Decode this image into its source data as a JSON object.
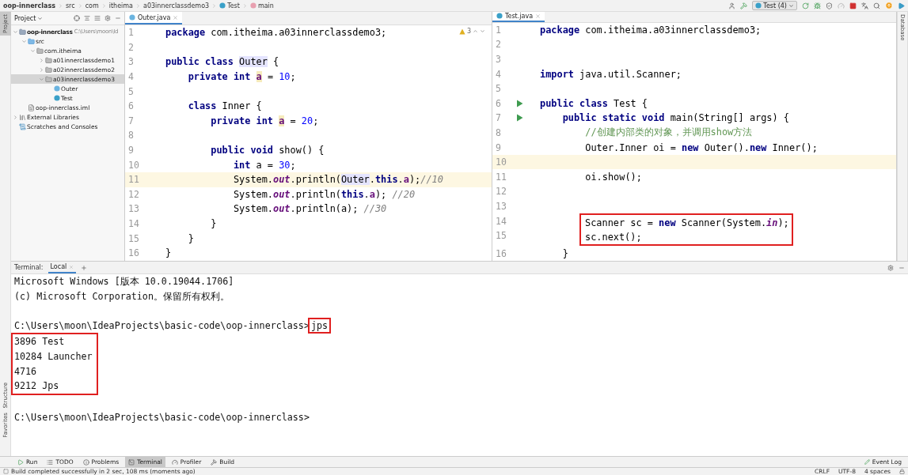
{
  "breadcrumbs": [
    {
      "kind": "project",
      "text": "oop-innerclass"
    },
    {
      "kind": "folder",
      "text": "src"
    },
    {
      "kind": "folder",
      "text": "com"
    },
    {
      "kind": "folder",
      "text": "itheima"
    },
    {
      "kind": "folder",
      "text": "a03innerclassdemo3"
    },
    {
      "kind": "class",
      "text": "Test"
    },
    {
      "kind": "method",
      "text": "main"
    }
  ],
  "run_config": "Test (4)",
  "left_stripe": [
    {
      "label": "Project",
      "selected": true
    },
    {
      "label": "Structure",
      "selected": false
    },
    {
      "label": "Favorites",
      "selected": false
    }
  ],
  "right_stripe": [
    {
      "label": "Database"
    }
  ],
  "project_panel": {
    "title": "Project",
    "tree": [
      {
        "kind": "module",
        "label": "oop-innerclass",
        "detail": "C:\\Users\\moon\\Id",
        "expanded": true,
        "selected": false,
        "children": [
          {
            "kind": "source",
            "label": "src",
            "expanded": true,
            "selected": false,
            "children": [
              {
                "kind": "package",
                "label": "com.itheima",
                "expanded": true,
                "selected": false,
                "children": [
                  {
                    "kind": "package",
                    "label": "a01innerclassdemo1",
                    "expanded": false,
                    "selected": false
                  },
                  {
                    "kind": "package",
                    "label": "a02innerclassdemo2",
                    "expanded": false,
                    "selected": false
                  },
                  {
                    "kind": "package",
                    "label": "a03innerclassdemo3",
                    "expanded": true,
                    "selected": true,
                    "children": [
                      {
                        "kind": "class",
                        "label": "Outer",
                        "selected": false
                      },
                      {
                        "kind": "main",
                        "label": "Test",
                        "selected": false
                      }
                    ]
                  }
                ]
              }
            ]
          },
          {
            "kind": "iml",
            "label": "oop-innerclass.iml",
            "selected": false
          }
        ]
      },
      {
        "kind": "library",
        "label": "External Libraries",
        "expanded": false,
        "selected": false
      },
      {
        "kind": "scratch",
        "label": "Scratches and Consoles",
        "selected": false
      }
    ]
  },
  "editors": [
    {
      "tab": {
        "kind": "class",
        "title": "Outer.java"
      },
      "warnings": "3",
      "lines": [
        {
          "kind": "line",
          "n": "1",
          "code": [
            {
              "kind": "kw",
              "text": "package"
            },
            {
              "kind": "tx",
              "text": " com.itheima.a03innerclassdemo3;"
            }
          ]
        },
        {
          "kind": "line",
          "n": "2"
        },
        {
          "kind": "line",
          "n": "3",
          "code": [
            {
              "kind": "kw",
              "text": "public class "
            },
            {
              "kind": "ref",
              "text": "Outer"
            },
            {
              "kind": "tx",
              "text": " {"
            }
          ]
        },
        {
          "kind": "line",
          "n": "4",
          "code": [
            {
              "kind": "kw",
              "text": "    private int "
            },
            {
              "kind": "var",
              "text": "a"
            },
            {
              "kind": "tx",
              "text": " = "
            },
            {
              "kind": "num",
              "text": "10"
            },
            {
              "kind": "tx",
              "text": ";"
            }
          ]
        },
        {
          "kind": "line",
          "n": "5"
        },
        {
          "kind": "line",
          "n": "6",
          "code": [
            {
              "kind": "kw",
              "text": "    class "
            },
            {
              "kind": "tx",
              "text": "Inner {"
            }
          ]
        },
        {
          "kind": "line",
          "n": "7",
          "code": [
            {
              "kind": "kw",
              "text": "        private int "
            },
            {
              "kind": "var",
              "text": "a"
            },
            {
              "kind": "tx",
              "text": " = "
            },
            {
              "kind": "num",
              "text": "20"
            },
            {
              "kind": "tx",
              "text": ";"
            }
          ]
        },
        {
          "kind": "line",
          "n": "8"
        },
        {
          "kind": "line",
          "n": "9",
          "code": [
            {
              "kind": "kw",
              "text": "        public void "
            },
            {
              "kind": "tx",
              "text": "show() {"
            }
          ]
        },
        {
          "kind": "line",
          "n": "10",
          "code": [
            {
              "kind": "kw",
              "text": "            int "
            },
            {
              "kind": "tx",
              "text": "a = "
            },
            {
              "kind": "num",
              "text": "30"
            },
            {
              "kind": "tx",
              "text": ";"
            }
          ]
        },
        {
          "kind": "line",
          "n": "11",
          "current": true,
          "code": [
            {
              "kind": "tx",
              "text": "            System."
            },
            {
              "kind": "static",
              "text": "out"
            },
            {
              "kind": "tx",
              "text": ".println("
            },
            {
              "kind": "ref",
              "text": "Outer"
            },
            {
              "kind": "tx",
              "text": "."
            },
            {
              "kind": "kw",
              "text": "this"
            },
            {
              "kind": "tx",
              "text": "."
            },
            {
              "kind": "fld",
              "text": "a"
            },
            {
              "kind": "tx",
              "text": ");"
            },
            {
              "kind": "cmt",
              "text": "//10"
            }
          ]
        },
        {
          "kind": "line",
          "n": "12",
          "code": [
            {
              "kind": "tx",
              "text": "            System."
            },
            {
              "kind": "static",
              "text": "out"
            },
            {
              "kind": "tx",
              "text": ".println("
            },
            {
              "kind": "kw",
              "text": "this"
            },
            {
              "kind": "tx",
              "text": "."
            },
            {
              "kind": "fld",
              "text": "a"
            },
            {
              "kind": "tx",
              "text": "); "
            },
            {
              "kind": "cmt",
              "text": "//20"
            }
          ]
        },
        {
          "kind": "line",
          "n": "13",
          "code": [
            {
              "kind": "tx",
              "text": "            System."
            },
            {
              "kind": "static",
              "text": "out"
            },
            {
              "kind": "tx",
              "text": ".println(a); "
            },
            {
              "kind": "cmt",
              "text": "//30"
            }
          ]
        },
        {
          "kind": "line",
          "n": "14",
          "code": [
            {
              "kind": "tx",
              "text": "        }"
            }
          ]
        },
        {
          "kind": "line",
          "n": "15",
          "code": [
            {
              "kind": "tx",
              "text": "    }"
            }
          ]
        },
        {
          "kind": "line",
          "n": "16",
          "code": [
            {
              "kind": "tx",
              "text": "}"
            }
          ]
        }
      ]
    },
    {
      "tab": {
        "kind": "main",
        "title": "Test.java"
      },
      "lines": [
        {
          "kind": "line",
          "n": "1",
          "code": [
            {
              "kind": "kw",
              "text": "package"
            },
            {
              "kind": "tx",
              "text": " com.itheima.a03innerclassdemo3;"
            }
          ]
        },
        {
          "kind": "line",
          "n": "2"
        },
        {
          "kind": "line",
          "n": "3"
        },
        {
          "kind": "line",
          "n": "4",
          "code": [
            {
              "kind": "kw",
              "text": "import"
            },
            {
              "kind": "tx",
              "text": " java.util.Scanner;"
            }
          ]
        },
        {
          "kind": "line",
          "n": "5"
        },
        {
          "kind": "line",
          "n": "6",
          "run": true,
          "code": [
            {
              "kind": "kw",
              "text": "public class "
            },
            {
              "kind": "tx",
              "text": "Test {"
            }
          ]
        },
        {
          "kind": "line",
          "n": "7",
          "run": true,
          "code": [
            {
              "kind": "kw",
              "text": "    public static void "
            },
            {
              "kind": "tx",
              "text": "main(String[] args) {"
            }
          ]
        },
        {
          "kind": "line",
          "n": "8",
          "code": [
            {
              "kind": "cmt2",
              "text": "        //创建内部类的对象，并调用show方法"
            }
          ]
        },
        {
          "kind": "line",
          "n": "9",
          "code": [
            {
              "kind": "tx",
              "text": "        Outer.Inner oi = "
            },
            {
              "kind": "kw",
              "text": "new "
            },
            {
              "kind": "tx",
              "text": "Outer()."
            },
            {
              "kind": "kw",
              "text": "new "
            },
            {
              "kind": "tx",
              "text": "Inner();"
            }
          ]
        },
        {
          "kind": "line",
          "n": "10",
          "current": true
        },
        {
          "kind": "line",
          "n": "11",
          "code": [
            {
              "kind": "tx",
              "text": "        oi.show();"
            }
          ]
        },
        {
          "kind": "line",
          "n": "12"
        },
        {
          "kind": "line",
          "n": "13"
        },
        {
          "kind": "group",
          "boxed": true,
          "lines": [
            {
              "kind": "line",
              "n": "14",
              "code": [
                {
                  "kind": "tx",
                  "text": "Scanner sc = "
                },
                {
                  "kind": "kw",
                  "text": "new "
                },
                {
                  "kind": "tx",
                  "text": "Scanner(System."
                },
                {
                  "kind": "static",
                  "text": "in"
                },
                {
                  "kind": "tx",
                  "text": ");"
                }
              ]
            },
            {
              "kind": "line",
              "n": "15",
              "code": [
                {
                  "kind": "tx",
                  "text": "sc.next();"
                }
              ]
            }
          ]
        },
        {
          "kind": "line",
          "n": "16",
          "code": [
            {
              "kind": "tx",
              "text": "    }"
            }
          ]
        }
      ]
    }
  ],
  "terminal": {
    "label": "Terminal:",
    "tabs": [
      {
        "title": "Local",
        "selected": true
      }
    ],
    "lines": [
      {
        "kind": "text",
        "text": "Microsoft Windows [版本 10.0.19044.1706]"
      },
      {
        "kind": "text",
        "text": "(c) Microsoft Corporation。保留所有权利。"
      },
      {
        "kind": "blank"
      },
      {
        "kind": "prompt",
        "text": "C:\\Users\\moon\\IdeaProjects\\basic-code\\oop-innerclass>",
        "command": "jps",
        "boxed": true
      },
      {
        "kind": "group",
        "boxed": true,
        "lines": [
          "3896 Test",
          "10284 Launcher",
          "4716",
          "9212 Jps"
        ]
      },
      {
        "kind": "blank"
      },
      {
        "kind": "prompt",
        "text": "C:\\Users\\moon\\IdeaProjects\\basic-code\\oop-innerclass>",
        "boxed": false
      }
    ]
  },
  "tool_tabs": [
    {
      "kind": "run",
      "label": "Run",
      "selected": false
    },
    {
      "kind": "todo",
      "label": "TODO",
      "selected": false
    },
    {
      "kind": "problems",
      "label": "Problems",
      "selected": false
    },
    {
      "kind": "terminal",
      "label": "Terminal",
      "selected": true
    },
    {
      "kind": "profiler",
      "label": "Profiler",
      "selected": false
    },
    {
      "kind": "build",
      "label": "Build",
      "selected": false
    }
  ],
  "event_log": "Event Log",
  "status_bar": {
    "message": "Build completed successfully in 2 sec, 108 ms (moments ago)",
    "items": [
      "CRLF",
      "UTF-8",
      "4 spaces"
    ]
  }
}
